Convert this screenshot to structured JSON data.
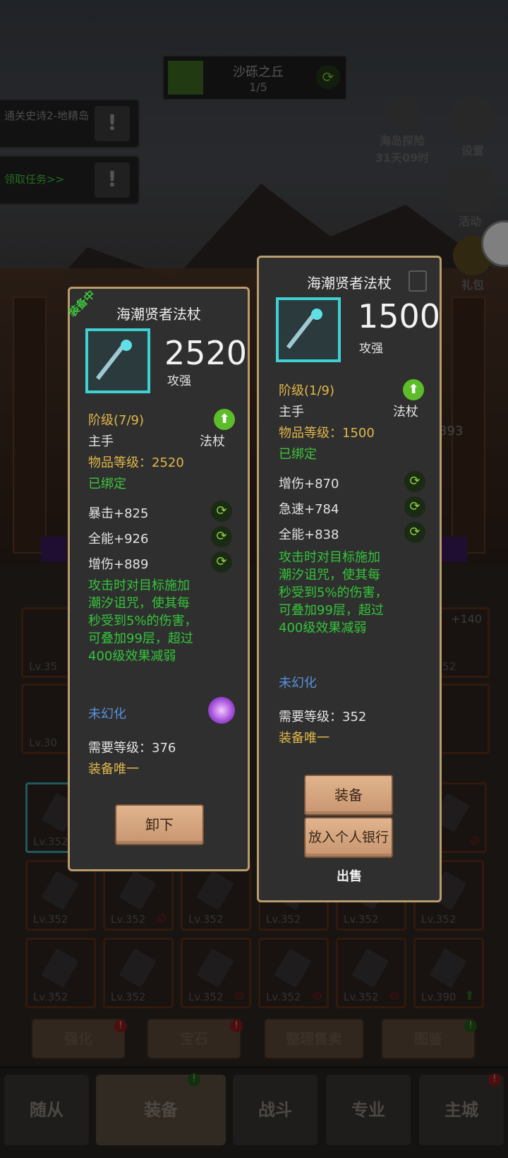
{
  "location": {
    "name": "沙砾之丘",
    "progress": "1/5"
  },
  "quests": [
    {
      "text": "通关史诗2-地精岛"
    },
    {
      "text": "领取任务>>"
    }
  ],
  "right_icons": {
    "island": "海岛探险",
    "island_timer": "31天09时",
    "settings": "设置",
    "activity": "活动",
    "pack": "礼包"
  },
  "equipped_card": {
    "tag": "装备中",
    "name": "海潮贤者法杖",
    "score": "2520",
    "score_label": "攻强",
    "tier": "阶级(7/9)",
    "slot": "主手",
    "type": "法杖",
    "item_level": "物品等级：2520",
    "bound": "已绑定",
    "stats": [
      "暴击+825",
      "全能+926",
      "增伤+889"
    ],
    "effect": "攻击时对目标施加\n潮汐诅咒，使其每\n秒受到5%的伤害，\n可叠加99层，超过\n400级效果减弱",
    "transmog": "未幻化",
    "req_level": "需要等级：376",
    "unique": "装备唯一",
    "button": "卸下"
  },
  "compare_card": {
    "name": "海潮贤者法杖",
    "score": "1500",
    "score_label": "攻强",
    "tier": "阶级(1/9)",
    "slot": "主手",
    "type": "法杖",
    "item_level": "物品等级：1500",
    "bound": "已绑定",
    "stats": [
      "增伤+870",
      "急速+784",
      "全能+838"
    ],
    "effect": "攻击时对目标施加\n潮汐诅咒，使其每\n秒受到5%的伤害，\n可叠加99层，超过\n400级效果减弱",
    "transmog": "未幻化",
    "req_level": "需要等级：352",
    "unique": "装备唯一",
    "btn_equip": "装备",
    "btn_bank": "放入个人银行",
    "btn_sell": "出售"
  },
  "side_text": {
    "num": "393",
    "plus140": "+140",
    "plus1": "+1",
    "lv_a": "Lv.35",
    "lv_b": "Lv.30",
    "lv_c": "Lv.352",
    "lv_d": "v.352"
  },
  "inventory": {
    "row1": [
      "Lv.352",
      "52"
    ],
    "row2": [
      "Lv.352",
      "Lv.352",
      "Lv.352",
      "Lv.352",
      "Lv.352",
      "Lv.352"
    ],
    "row3": [
      "Lv.352",
      "Lv.352",
      "Lv.352",
      "Lv.352",
      "Lv.352",
      "Lv.390"
    ]
  },
  "actions": [
    "强化",
    "宝石",
    "整理售卖",
    "图鉴"
  ],
  "nav": [
    "随从",
    "装备",
    "战斗",
    "专业",
    "主城"
  ],
  "colors": {
    "accent_gold": "#e0b74a",
    "accent_green": "#3ec43a",
    "card_border": "#b99c6c",
    "icon_border": "#3fd1d2"
  }
}
